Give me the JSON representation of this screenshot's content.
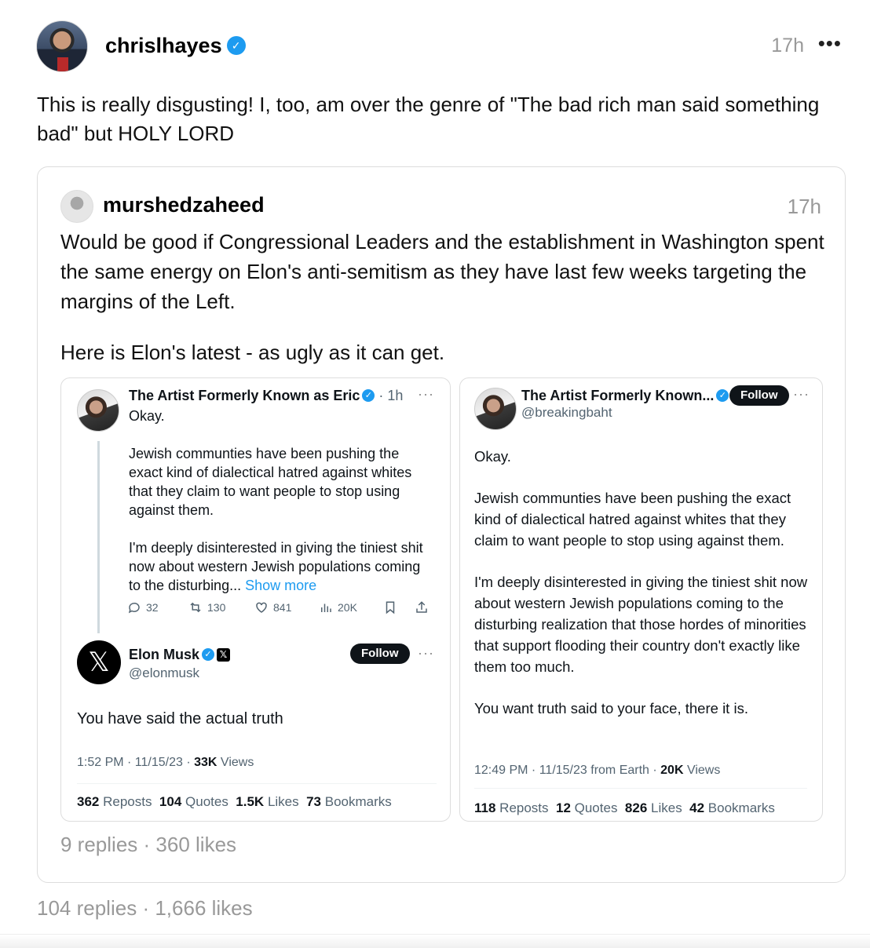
{
  "post": {
    "username": "chrislhayes",
    "time": "17h",
    "more": "•••",
    "text": "This is really disgusting! I, too, am over the genre of \"The bad rich man said something bad\" but HOLY LORD",
    "replies": "104 replies",
    "sep": "·",
    "likes": "1,666 likes"
  },
  "quote": {
    "username": "murshedzaheed",
    "time": "17h",
    "text1": "Would be good if Congressional Leaders and the establishment in Washington spent the same energy on Elon's anti-semitism as they have last few weeks targeting the margins of the Left.",
    "text2": "Here is Elon's latest - as ugly as it can get.",
    "replies": "9 replies",
    "sep": "·",
    "likes": "360 likes"
  },
  "left_shot": {
    "reply_name": "The Artist Formerly Known as Eric",
    "reply_time": "· 1h",
    "more": "···",
    "reply_line1": "Okay.",
    "reply_para1": "Jewish communties have been pushing the exact kind of dialectical hatred against whites that they claim to want people to stop using against them.",
    "reply_para2": "I'm deeply disinterested in giving the tiniest shit now about western Jewish populations coming to the disturbing...",
    "show_more": "Show more",
    "actions": {
      "replies": "32",
      "reposts": "130",
      "likes": "841",
      "views": "20K"
    },
    "author_name": "Elon Musk",
    "author_handle": "@elonmusk",
    "follow": "Follow",
    "tweet": "You have said the actual truth",
    "meta_time": "1:52 PM · 11/15/23 · ",
    "meta_views": "33K",
    "meta_views_label": " Views",
    "counts": [
      {
        "n": "362",
        "label": " Reposts"
      },
      {
        "n": "104",
        "label": " Quotes"
      },
      {
        "n": "1.5K",
        "label": " Likes"
      },
      {
        "n": "73",
        "label": " Bookmarks"
      }
    ]
  },
  "right_shot": {
    "name": "The Artist Formerly Known...",
    "handle": "@breakingbaht",
    "follow": "Follow",
    "more": "···",
    "line1": "Okay.",
    "para1": "Jewish communties have been pushing the exact kind of dialectical hatred against whites that they claim to want people to stop using against them.",
    "para2": "I'm deeply disinterested in giving the tiniest shit now about western Jewish populations coming to the disturbing realization that those hordes of minorities that support flooding their country don't exactly like them too much.",
    "para3": "You want truth said to your face, there it is.",
    "meta_time": "12:49 PM · 11/15/23 from Earth · ",
    "meta_views": "20K",
    "meta_views_label": " Views",
    "counts": [
      {
        "n": "118",
        "label": " Reposts"
      },
      {
        "n": "12",
        "label": " Quotes"
      },
      {
        "n": "826",
        "label": " Likes"
      },
      {
        "n": "42",
        "label": " Bookmarks"
      }
    ]
  },
  "colors": {
    "verified": "#1d9bf0",
    "link": "#1d9bf0",
    "muted": "#999999"
  },
  "icons": [
    "verified-badge-icon",
    "more-icon",
    "reply-icon",
    "repost-icon",
    "like-icon",
    "views-icon",
    "bookmark-icon",
    "share-icon",
    "x-logo-icon"
  ]
}
